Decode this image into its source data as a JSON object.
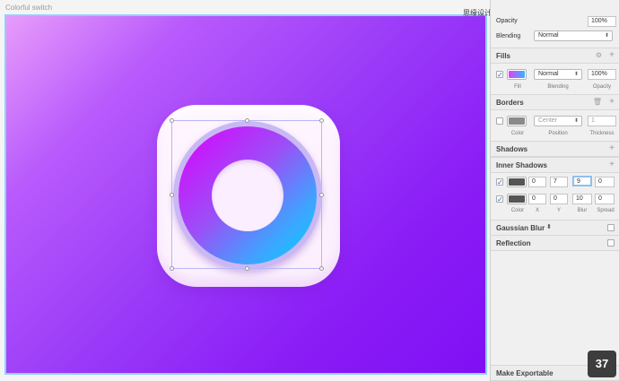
{
  "canvas": {
    "title": "Colorful switch"
  },
  "watermark": "思缘设计论坛 WWW.MISSYUAN.COM",
  "inspector": {
    "opacity_label": "Opacity",
    "opacity_value": "100%",
    "blending_label": "Blending",
    "blending_value": "Normal",
    "fills": {
      "title": "Fills",
      "mode": "Normal",
      "opacity": "100%",
      "captions": {
        "fill": "Fill",
        "blending": "Blending",
        "opacity": "Opacity"
      }
    },
    "borders": {
      "title": "Borders",
      "position": "Center",
      "thickness": "1",
      "captions": {
        "color": "Color",
        "position": "Position",
        "thickness": "Thickness"
      }
    },
    "shadows": {
      "title": "Shadows"
    },
    "inner_shadows": {
      "title": "Inner Shadows",
      "rows": [
        {
          "x": "0",
          "y": "7",
          "blur": "9",
          "spread": "0"
        },
        {
          "x": "0",
          "y": "0",
          "blur": "10",
          "spread": "0"
        }
      ],
      "captions": {
        "color": "Color",
        "x": "X",
        "y": "Y",
        "blur": "Blur",
        "spread": "Spread"
      }
    },
    "gaussian_blur": {
      "title": "Gaussian Blur"
    },
    "reflection": {
      "title": "Reflection"
    },
    "make_exportable": "Make Exportable"
  },
  "page_number": "37",
  "colors": {
    "selection": "#8fcfff",
    "fill_swatch_start": "#6a7df5",
    "fill_swatch_end": "#35b6ff",
    "shadow_swatch": "#555555",
    "border_swatch": "#8a8a8a"
  }
}
